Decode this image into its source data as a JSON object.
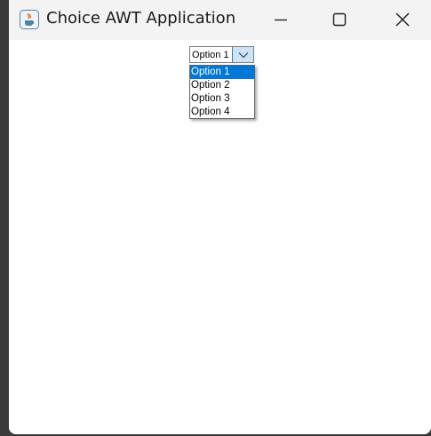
{
  "window": {
    "title": "Choice AWT Application",
    "app_icon": "java-coffee-cup-icon",
    "controls": [
      "minimize-icon",
      "maximize-icon",
      "close-icon"
    ]
  },
  "choice": {
    "selected_value": "Option 1",
    "arrow_icon": "chevron-down-icon",
    "accent": "#cce4f7"
  },
  "popup": {
    "items": [
      {
        "label": "Option 1",
        "selected": true
      },
      {
        "label": "Option 2",
        "selected": false
      },
      {
        "label": "Option 3",
        "selected": false
      },
      {
        "label": "Option 4",
        "selected": false
      }
    ],
    "selection_color": "#0078d7"
  }
}
